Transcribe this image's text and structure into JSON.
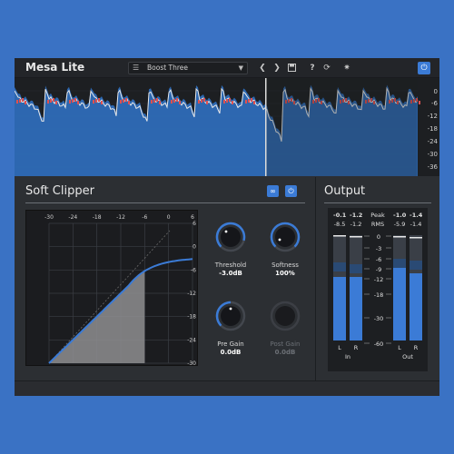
{
  "header": {
    "title": "Mesa Lite",
    "preset_name": "Boost Three",
    "help_label": "?"
  },
  "waveform": {
    "scale_labels": [
      "0",
      "-6",
      "-12",
      "-18",
      "-24",
      "-30",
      "-36"
    ]
  },
  "soft_clipper": {
    "title": "Soft Clipper",
    "x_ticks": [
      "-30",
      "-24",
      "-18",
      "-12",
      "-6",
      "0",
      "6"
    ],
    "y_ticks": [
      "6",
      "0",
      "-6",
      "-12",
      "-18",
      "-24",
      "-30"
    ],
    "knobs": {
      "threshold": {
        "label": "Threshold",
        "value": "-3.0dB"
      },
      "softness": {
        "label": "Softness",
        "value": "100%"
      },
      "pre_gain": {
        "label": "Pre Gain",
        "value": "0.0dB"
      },
      "post_gain": {
        "label": "Post Gain",
        "value": "0.0dB"
      }
    }
  },
  "output": {
    "title": "Output",
    "peak_label": "Peak",
    "rms_label": "RMS",
    "in_peak": [
      "-0.1",
      "-1.2"
    ],
    "in_rms": [
      "-8.5",
      "-1.2"
    ],
    "out_peak": [
      "-1.0",
      "-1.4"
    ],
    "out_rms": [
      "-5.9",
      "-1.4"
    ],
    "scale": [
      "0",
      "-3",
      "-6",
      "-9",
      "-12",
      "-18",
      "-30",
      "-60"
    ],
    "in_channels": [
      "L",
      "R"
    ],
    "out_channels": [
      "L",
      "R"
    ],
    "in_label": "In",
    "out_label": "Out"
  },
  "colors": {
    "accent": "#3b7bd6",
    "background": "#3a72c4",
    "panel": "#2c2f33",
    "waveform_fill": "#2e6cb8",
    "clip_red": "#e05050"
  },
  "icons": {
    "preset_list": "list-icon",
    "prev": "chevron-left-icon",
    "next": "chevron-right-icon",
    "save": "save-icon",
    "help": "help-icon",
    "reset": "refresh-icon",
    "settings": "gear-icon",
    "power": "power-icon",
    "link": "link-icon"
  }
}
